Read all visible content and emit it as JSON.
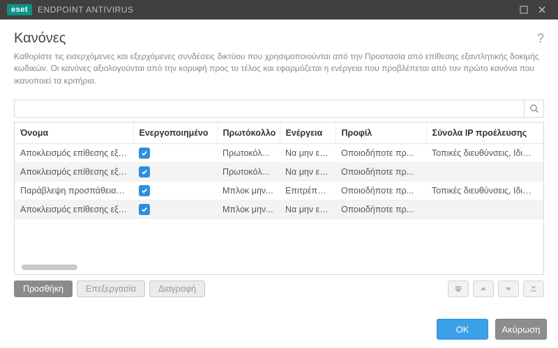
{
  "titlebar": {
    "brand_badge": "eset",
    "brand_name": "ENDPOINT ANTIVIRUS"
  },
  "header": {
    "title": "Κανόνες",
    "help_tooltip": "?",
    "description": "Καθορίστε τις εισερχόμενες και εξερχόμενες συνδέσεις δικτύου που χρησιμοποιούνται από την Προστασία από επίθεσης εξαντλητικής δοκιμής κωδικών. Οι κανόνες αξιολογούνται από την κορυφή προς το τέλος και εφαρμόζεται η ενέργεια που προβλέπεται από τον πρώτο κανόνα που ικανοποιεί τα κριτήρια."
  },
  "search": {
    "placeholder": ""
  },
  "columns": {
    "name": "Όνομα",
    "enabled": "Ενεργοποιημένο",
    "protocol": "Πρωτόκολλο",
    "action": "Ενέργεια",
    "profile": "Προφίλ",
    "source": "Σύνολα IP προέλευσης"
  },
  "rows": [
    {
      "name": "Αποκλεισμός επίθεσης εξαν...",
      "enabled": true,
      "protocol": "Πρωτοκόλ...",
      "action": "Να μην επι...",
      "profile": "Οποιοδήποτε πρ...",
      "source": "Τοπικές διευθύνσεις, Ιδιωτικές διε"
    },
    {
      "name": "Αποκλεισμός επίθεσης εξαν...",
      "enabled": true,
      "protocol": "Πρωτοκόλ...",
      "action": "Να μην επι...",
      "profile": "Οποιοδήποτε πρ...",
      "source": ""
    },
    {
      "name": "Παράβλεψη προσπάθειας κ...",
      "enabled": true,
      "protocol": "Μπλοκ μην...",
      "action": "Επιτρέπεται",
      "profile": "Οποιοδήποτε πρ...",
      "source": "Τοπικές διευθύνσεις, Ιδιωτικές διε"
    },
    {
      "name": "Αποκλεισμός επίθεσης εξαν...",
      "enabled": true,
      "protocol": "Μπλοκ μην...",
      "action": "Να μην επι...",
      "profile": "Οποιοδήποτε πρ...",
      "source": ""
    }
  ],
  "buttons": {
    "add": "Προσθήκη",
    "edit": "Επεξεργασία",
    "delete": "Διαγραφή"
  },
  "footer": {
    "ok": "OK",
    "cancel": "Ακύρωση"
  }
}
